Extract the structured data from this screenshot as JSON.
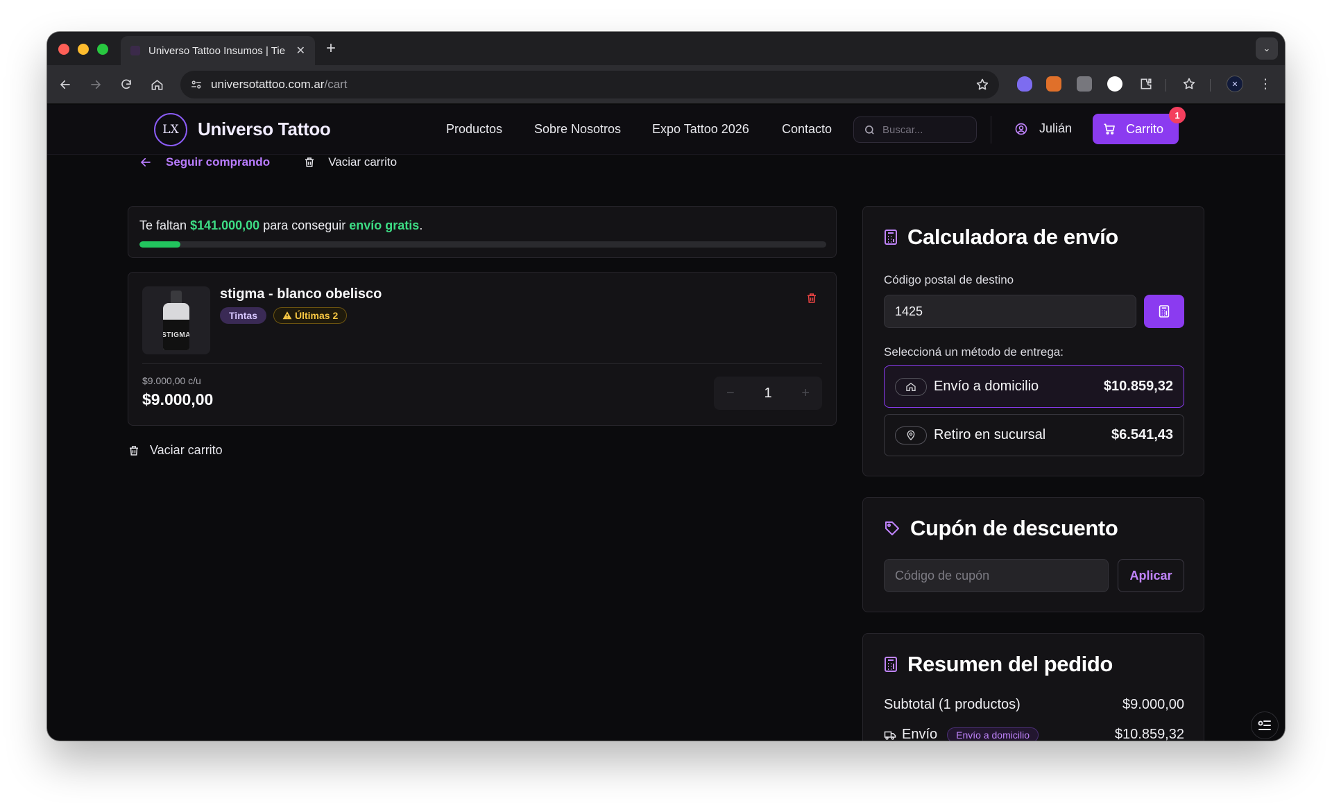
{
  "browser": {
    "tab_title": "Universo Tattoo Insumos | Tie",
    "url_domain": "universotattoo.com.ar",
    "url_path": "/cart"
  },
  "site": {
    "logo_text": "LX",
    "brand": "Universo Tattoo",
    "nav": [
      "Productos",
      "Sobre Nosotros",
      "Expo Tattoo 2026",
      "Contacto"
    ],
    "search_placeholder": "Buscar...",
    "user_name": "Julián",
    "cart_label": "Carrito",
    "cart_count": "1"
  },
  "cart": {
    "back_label": "Seguir comprando",
    "clear_label": "Vaciar carrito",
    "shipping_progress": {
      "prefix": "Te faltan",
      "amount": "$141.000,00",
      "middle": "para conseguir",
      "highlight": "envío gratis",
      "suffix": ".",
      "fill_percent": 6
    },
    "item": {
      "name": "stigma - blanco obelisco",
      "category": "Tintas",
      "stock_badge": "Últimas 2",
      "bottle_label": "STIGMA",
      "unit_price": "$9.000,00 c/u",
      "total": "$9.000,00",
      "quantity": "1"
    }
  },
  "shipping_calculator": {
    "title": "Calculadora de envío",
    "postal_label": "Código postal de destino",
    "postal_value": "1425",
    "method_label": "Seleccioná un método de entrega:",
    "options": [
      {
        "name": "Envío a domicilio",
        "price": "$10.859,32",
        "selected": true
      },
      {
        "name": "Retiro en sucursal",
        "price": "$6.541,43",
        "selected": false
      }
    ]
  },
  "coupon": {
    "title": "Cupón de descuento",
    "placeholder": "Código de cupón",
    "apply_label": "Aplicar"
  },
  "summary": {
    "title": "Resumen del pedido",
    "subtotal_label": "Subtotal (1 productos)",
    "subtotal_value": "$9.000,00",
    "shipping_label": "Envío",
    "shipping_method": "Envío a domicilio",
    "shipping_value": "$10.859,32"
  },
  "colors": {
    "accent": "#8b3bf0",
    "success": "#22c55e",
    "danger": "#ef4444",
    "warning": "#f5c542"
  }
}
